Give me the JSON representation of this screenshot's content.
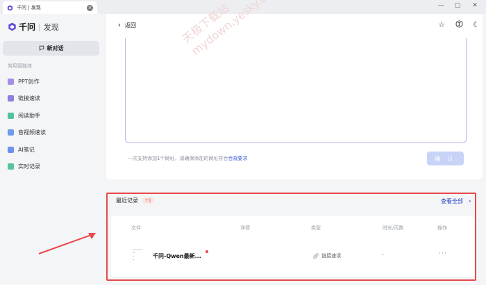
{
  "tab": {
    "title": "千问 | 发现",
    "close": "×"
  },
  "window": {
    "minimize": "—",
    "maximize": "▢",
    "close": "✕"
  },
  "brand": {
    "name": "千问",
    "separator": "|",
    "section": "发现",
    "accent": "#5b4dd6"
  },
  "sidebar": {
    "new_chat": "新对话",
    "section_label": "常用智能体",
    "items": [
      {
        "label": "PPT创作",
        "icon": "ppt-icon",
        "color": "#a58ee6"
      },
      {
        "label": "链接速读",
        "icon": "link-read-icon",
        "color": "#8c7fe0"
      },
      {
        "label": "阅读助手",
        "icon": "reading-assistant-icon",
        "color": "#4fc3a1"
      },
      {
        "label": "音视频速读",
        "icon": "audio-video-icon",
        "color": "#6f9be8"
      },
      {
        "label": "AI笔记",
        "icon": "ai-notes-icon",
        "color": "#6f8ff0"
      },
      {
        "label": "实时记录",
        "icon": "realtime-record-icon",
        "color": "#58c49b"
      }
    ]
  },
  "header": {
    "back_label": "返回"
  },
  "watermark": {
    "line1": "天极下载站",
    "line2": "mydown.yesky.com"
  },
  "input_area": {
    "hint": "一次支持添加1个网址，请确保添加的网址符合",
    "hint_link": "合规要求",
    "confirm_label": "确 认"
  },
  "recent": {
    "title": "最近记录",
    "badge": "+1",
    "view_all": "查看全部",
    "columns": [
      "文件",
      "详情",
      "类型",
      "时长/页数",
      "操作"
    ],
    "rows": [
      {
        "file_name": "千问-Qwen最新...",
        "detail": "",
        "type": "链接速读",
        "duration": "-",
        "actions": "···"
      }
    ]
  },
  "colors": {
    "highlight_frame": "#e8484c",
    "link": "#2340c9",
    "confirm_disabled": "#c7d3f7"
  }
}
